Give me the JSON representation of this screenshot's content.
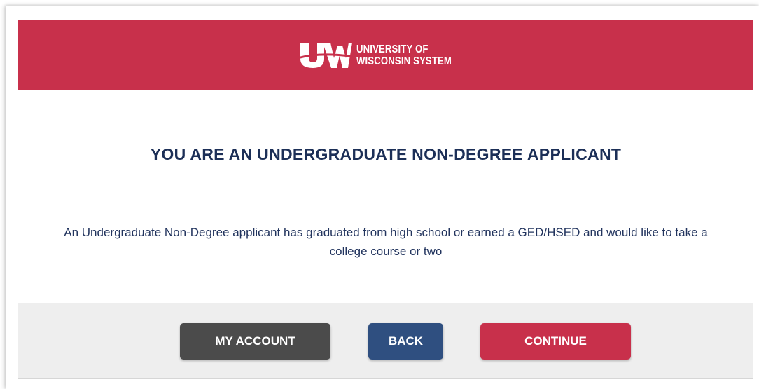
{
  "header": {
    "logo_line1": "UNIVERSITY OF",
    "logo_line2": "WISCONSIN SYSTEM",
    "background_color": "#c8304b"
  },
  "main": {
    "heading": "YOU ARE AN UNDERGRADUATE NON-DEGREE APPLICANT",
    "description": "An Undergraduate Non-Degree applicant has graduated from high school or earned a GED/HSED and would like to take a college course or two"
  },
  "footer": {
    "my_account_label": "MY ACCOUNT",
    "back_label": "BACK",
    "continue_label": "CONTINUE",
    "colors": {
      "my_account": "#4b4b4b",
      "back": "#2f4f80",
      "continue": "#c8304b"
    }
  }
}
